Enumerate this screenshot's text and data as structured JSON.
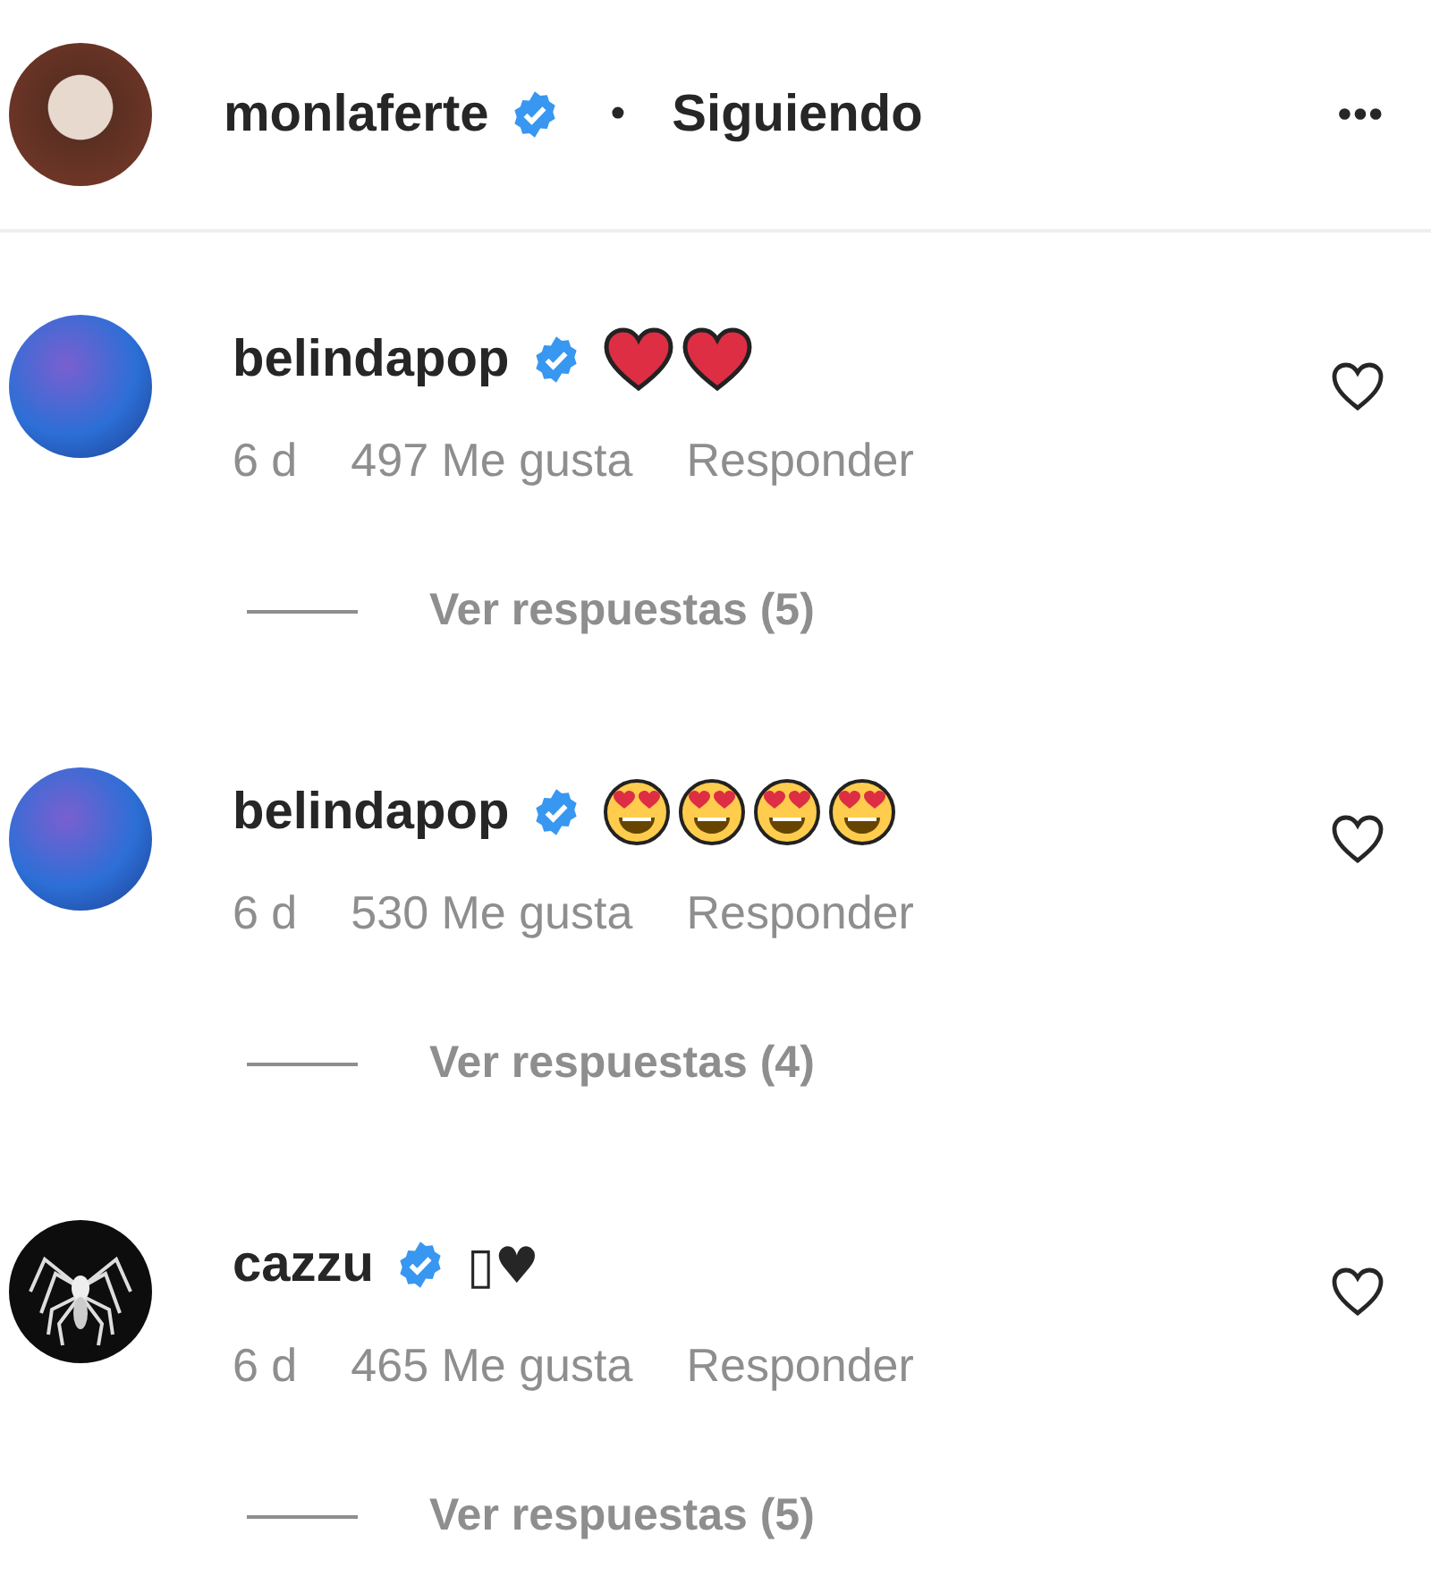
{
  "header": {
    "username": "monlaferte",
    "verified": true,
    "separator": "•",
    "follow_status": "Siguiendo",
    "more": "•••"
  },
  "comments": [
    {
      "username": "belindapop",
      "verified": true,
      "avatar": {
        "kind": "photo"
      },
      "body": {
        "kind": "emoji",
        "emoji": [
          {
            "kind": "heart"
          },
          {
            "kind": "heart"
          }
        ]
      },
      "age": "6 d",
      "likes": "497 Me gusta",
      "reply": "Responder",
      "replies": "Ver respuestas (5)"
    },
    {
      "username": "belindapop",
      "verified": true,
      "avatar": {
        "kind": "photo"
      },
      "body": {
        "kind": "emoji",
        "emoji": [
          {
            "kind": "heart-eyes"
          },
          {
            "kind": "heart-eyes"
          },
          {
            "kind": "heart-eyes"
          },
          {
            "kind": "heart-eyes"
          }
        ]
      },
      "age": "6 d",
      "likes": "530 Me gusta",
      "reply": "Responder",
      "replies": "Ver respuestas (4)"
    },
    {
      "username": "cazzu",
      "verified": true,
      "avatar": {
        "kind": "spider"
      },
      "body": {
        "kind": "text",
        "text": "▯♥"
      },
      "age": "6 d",
      "likes": "465 Me gusta",
      "reply": "Responder",
      "replies": "Ver respuestas (5)"
    }
  ]
}
